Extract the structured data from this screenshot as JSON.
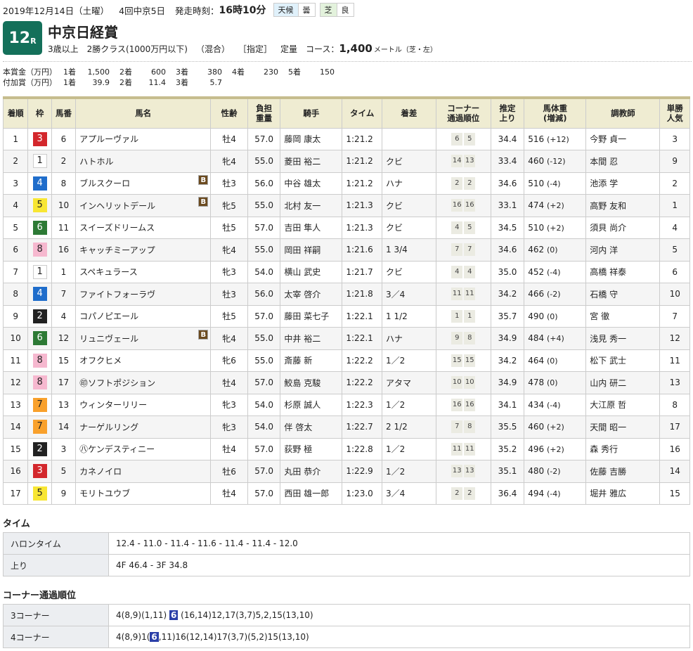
{
  "header": {
    "date": "2019年12月14日（土曜）",
    "meeting": "4回中京5日",
    "start_label": "発走時刻：",
    "start_time": "16時10分",
    "weather_label": "天候",
    "weather_value": "曇",
    "track_label": "芝",
    "track_value": "良"
  },
  "race": {
    "number": "12",
    "suffix": "R",
    "title": "中京日経賞",
    "conditions": [
      "3歳以上",
      "2勝クラス(1000万円以下)",
      "（混合）",
      "［指定］",
      "定量"
    ],
    "course_label": "コース：",
    "distance": "1,400",
    "distance_unit": "メートル（芝・左）"
  },
  "prize": {
    "main": {
      "label": "本賞金（万円）",
      "items": [
        {
          "place": "1着",
          "value": "1,500"
        },
        {
          "place": "2着",
          "value": "600"
        },
        {
          "place": "3着",
          "value": "380"
        },
        {
          "place": "4着",
          "value": "230"
        },
        {
          "place": "5着",
          "value": "150"
        }
      ]
    },
    "extra": {
      "label": "付加賞（万円）",
      "items": [
        {
          "place": "1着",
          "value": "39.9"
        },
        {
          "place": "2着",
          "value": "11.4"
        },
        {
          "place": "3着",
          "value": "5.7"
        }
      ]
    }
  },
  "results": {
    "columns": [
      "着順",
      "枠",
      "馬番",
      "馬名",
      "性齢",
      "負担\n重量",
      "騎手",
      "タイム",
      "着差",
      "コーナー\n通過順位",
      "推定\n上り",
      "馬体重\n(増減)",
      "調教師",
      "単勝\n人気"
    ],
    "rows": [
      {
        "place": "1",
        "waku": "3",
        "num": "6",
        "prefix": "",
        "name": "アプルーヴァル",
        "blinker": false,
        "sexage": "牡4",
        "weight": "57.0",
        "jockey": "藤岡 康太",
        "time": "1:21.2",
        "margin": "",
        "corners": [
          "6",
          "5"
        ],
        "last3f": "34.4",
        "bw": "516",
        "bwd": "(+12)",
        "trainer": "今野 貞一",
        "pop": "3"
      },
      {
        "place": "2",
        "waku": "1",
        "num": "2",
        "prefix": "",
        "name": "ハトホル",
        "blinker": false,
        "sexage": "牝4",
        "weight": "55.0",
        "jockey": "菱田 裕二",
        "time": "1:21.2",
        "margin": "クビ",
        "corners": [
          "14",
          "13"
        ],
        "last3f": "33.4",
        "bw": "460",
        "bwd": "(-12)",
        "trainer": "本間 忍",
        "pop": "9"
      },
      {
        "place": "3",
        "waku": "4",
        "num": "8",
        "prefix": "",
        "name": "ブルスクーロ",
        "blinker": true,
        "sexage": "牡3",
        "weight": "56.0",
        "jockey": "中谷 雄太",
        "time": "1:21.2",
        "margin": "ハナ",
        "corners": [
          "2",
          "2"
        ],
        "last3f": "34.6",
        "bw": "510",
        "bwd": "(-4)",
        "trainer": "池添 学",
        "pop": "2"
      },
      {
        "place": "4",
        "waku": "5",
        "num": "10",
        "prefix": "",
        "name": "インヘリットデール",
        "blinker": true,
        "sexage": "牝5",
        "weight": "55.0",
        "jockey": "北村 友一",
        "time": "1:21.3",
        "margin": "クビ",
        "corners": [
          "16",
          "16"
        ],
        "last3f": "33.1",
        "bw": "474",
        "bwd": "(+2)",
        "trainer": "高野 友和",
        "pop": "1"
      },
      {
        "place": "5",
        "waku": "6",
        "num": "11",
        "prefix": "",
        "name": "スイーズドリームス",
        "blinker": false,
        "sexage": "牡5",
        "weight": "57.0",
        "jockey": "吉田 隼人",
        "time": "1:21.3",
        "margin": "クビ",
        "corners": [
          "4",
          "5"
        ],
        "last3f": "34.5",
        "bw": "510",
        "bwd": "(+2)",
        "trainer": "須貝 尚介",
        "pop": "4"
      },
      {
        "place": "6",
        "waku": "8",
        "num": "16",
        "prefix": "",
        "name": "キャッチミーアップ",
        "blinker": false,
        "sexage": "牝4",
        "weight": "55.0",
        "jockey": "岡田 祥嗣",
        "time": "1:21.6",
        "margin": "1 3/4",
        "corners": [
          "7",
          "7"
        ],
        "last3f": "34.6",
        "bw": "462",
        "bwd": "(0)",
        "trainer": "河内 洋",
        "pop": "5"
      },
      {
        "place": "7",
        "waku": "1",
        "num": "1",
        "prefix": "",
        "name": "スペキュラース",
        "blinker": false,
        "sexage": "牝3",
        "weight": "54.0",
        "jockey": "横山 武史",
        "time": "1:21.7",
        "margin": "クビ",
        "corners": [
          "4",
          "4"
        ],
        "last3f": "35.0",
        "bw": "452",
        "bwd": "(-4)",
        "trainer": "高橋 祥泰",
        "pop": "6"
      },
      {
        "place": "8",
        "waku": "4",
        "num": "7",
        "prefix": "",
        "name": "ファイトフォーラヴ",
        "blinker": false,
        "sexage": "牡3",
        "weight": "56.0",
        "jockey": "太宰 啓介",
        "time": "1:21.8",
        "margin": "3／4",
        "corners": [
          "11",
          "11"
        ],
        "last3f": "34.2",
        "bw": "466",
        "bwd": "(-2)",
        "trainer": "石橋 守",
        "pop": "10"
      },
      {
        "place": "9",
        "waku": "2",
        "num": "4",
        "prefix": "",
        "name": "コパノピエール",
        "blinker": false,
        "sexage": "牡5",
        "weight": "57.0",
        "jockey": "藤田 菜七子",
        "time": "1:22.1",
        "margin": "1 1/2",
        "corners": [
          "1",
          "1"
        ],
        "last3f": "35.7",
        "bw": "490",
        "bwd": "(0)",
        "trainer": "宮 徹",
        "pop": "7"
      },
      {
        "place": "10",
        "waku": "6",
        "num": "12",
        "prefix": "",
        "name": "リュニヴェール",
        "blinker": true,
        "sexage": "牝4",
        "weight": "55.0",
        "jockey": "中井 裕二",
        "time": "1:22.1",
        "margin": "ハナ",
        "corners": [
          "9",
          "8"
        ],
        "last3f": "34.9",
        "bw": "484",
        "bwd": "(+4)",
        "trainer": "浅見 秀一",
        "pop": "12"
      },
      {
        "place": "11",
        "waku": "8",
        "num": "15",
        "prefix": "",
        "name": "オフクヒメ",
        "blinker": false,
        "sexage": "牝6",
        "weight": "55.0",
        "jockey": "斎藤 新",
        "time": "1:22.2",
        "margin": "1／2",
        "corners": [
          "15",
          "15"
        ],
        "last3f": "34.2",
        "bw": "464",
        "bwd": "(0)",
        "trainer": "松下 武士",
        "pop": "11"
      },
      {
        "place": "12",
        "waku": "8",
        "num": "17",
        "prefix": "㊞",
        "name": "ソフトポジション",
        "blinker": false,
        "sexage": "牡4",
        "weight": "57.0",
        "jockey": "鮫島 克駿",
        "time": "1:22.2",
        "margin": "アタマ",
        "corners": [
          "10",
          "10"
        ],
        "last3f": "34.9",
        "bw": "478",
        "bwd": "(0)",
        "trainer": "山内 研二",
        "pop": "13"
      },
      {
        "place": "13",
        "waku": "7",
        "num": "13",
        "prefix": "",
        "name": "ウィンターリリー",
        "blinker": false,
        "sexage": "牝3",
        "weight": "54.0",
        "jockey": "杉原 誠人",
        "time": "1:22.3",
        "margin": "1／2",
        "corners": [
          "16",
          "16"
        ],
        "last3f": "34.1",
        "bw": "434",
        "bwd": "(-4)",
        "trainer": "大江原 哲",
        "pop": "8"
      },
      {
        "place": "14",
        "waku": "7",
        "num": "14",
        "prefix": "",
        "name": "ナーゲルリング",
        "blinker": false,
        "sexage": "牝3",
        "weight": "54.0",
        "jockey": "伴 啓太",
        "time": "1:22.7",
        "margin": "2 1/2",
        "corners": [
          "7",
          "8"
        ],
        "last3f": "35.5",
        "bw": "460",
        "bwd": "(+2)",
        "trainer": "天間 昭一",
        "pop": "17"
      },
      {
        "place": "15",
        "waku": "2",
        "num": "3",
        "prefix": "㊇",
        "name": "ケンデスティニー",
        "blinker": false,
        "sexage": "牡4",
        "weight": "57.0",
        "jockey": "荻野 極",
        "time": "1:22.8",
        "margin": "1／2",
        "corners": [
          "11",
          "11"
        ],
        "last3f": "35.2",
        "bw": "496",
        "bwd": "(+2)",
        "trainer": "森 秀行",
        "pop": "16"
      },
      {
        "place": "16",
        "waku": "3",
        "num": "5",
        "prefix": "",
        "name": "カネノイロ",
        "blinker": false,
        "sexage": "牡6",
        "weight": "57.0",
        "jockey": "丸田 恭介",
        "time": "1:22.9",
        "margin": "1／2",
        "corners": [
          "13",
          "13"
        ],
        "last3f": "35.1",
        "bw": "480",
        "bwd": "(-2)",
        "trainer": "佐藤 吉勝",
        "pop": "14"
      },
      {
        "place": "17",
        "waku": "5",
        "num": "9",
        "prefix": "",
        "name": "モリトユウブ",
        "blinker": false,
        "sexage": "牡4",
        "weight": "57.0",
        "jockey": "西田 雄一郎",
        "time": "1:23.0",
        "margin": "3／4",
        "corners": [
          "2",
          "2"
        ],
        "last3f": "36.4",
        "bw": "494",
        "bwd": "(-4)",
        "trainer": "堀井 雅広",
        "pop": "15"
      }
    ],
    "blinker_label": "B"
  },
  "time_section": {
    "title": "タイム",
    "rows": [
      {
        "label": "ハロンタイム",
        "value": "12.4 - 11.0 - 11.4 - 11.6 - 11.4 - 11.4 - 12.0"
      },
      {
        "label": "上り",
        "value": "4F 46.4 - 3F 34.8"
      }
    ]
  },
  "corner_section": {
    "title": "コーナー通過順位",
    "rows": [
      {
        "label": "3コーナー",
        "before": "4(8,9)(1,11) ",
        "highlight": "6",
        "after": " (16,14)12,17(3,7)5,2,15(13,10)"
      },
      {
        "label": "4コーナー",
        "before": "4(8,9)1(",
        "highlight": "6",
        "after": ",11)16(12,14)17(3,7)(5,2)15(13,10)"
      }
    ]
  }
}
